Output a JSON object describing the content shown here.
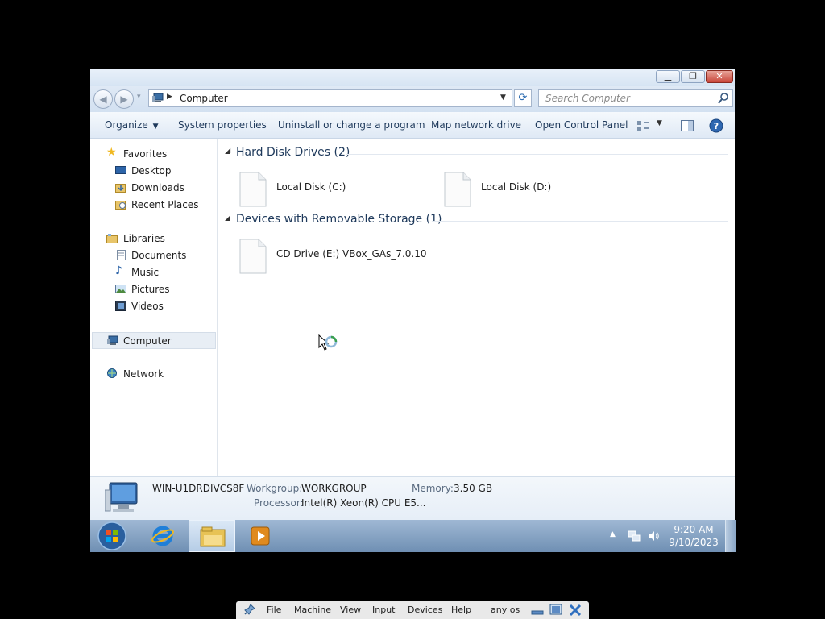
{
  "window": {
    "address_path": "Computer",
    "search_placeholder": "Search Computer"
  },
  "toolbar": {
    "organize": "Organize",
    "system_properties": "System properties",
    "uninstall": "Uninstall or change a program",
    "map_drive": "Map network drive",
    "control_panel": "Open Control Panel"
  },
  "nav": {
    "favorites": "Favorites",
    "desktop": "Desktop",
    "downloads": "Downloads",
    "recent_places": "Recent Places",
    "libraries": "Libraries",
    "documents": "Documents",
    "music": "Music",
    "pictures": "Pictures",
    "videos": "Videos",
    "computer": "Computer",
    "network": "Network"
  },
  "groups": {
    "hard_disk": {
      "title": "Hard Disk Drives (2)",
      "items": [
        "Local Disk (C:)",
        "Local Disk (D:)"
      ]
    },
    "removable": {
      "title": "Devices with Removable Storage (1)",
      "items": [
        "CD Drive (E:) VBox_GAs_7.0.10"
      ]
    }
  },
  "details": {
    "computer_name": "WIN-U1DRDIVCS8F",
    "workgroup_label": "Workgroup:",
    "workgroup_value": "WORKGROUP",
    "memory_label": "Memory:",
    "memory_value": "3.50 GB",
    "processor_label": "Processor:",
    "processor_value": "Intel(R) Xeon(R) CPU E5..."
  },
  "taskbar": {
    "time": "9:20 AM",
    "date": "9/10/2023"
  },
  "vbox": {
    "menus": [
      "File",
      "Machine",
      "View",
      "Input",
      "Devices",
      "Help"
    ],
    "status": "any os"
  },
  "colors": {
    "accent": "#1e395b",
    "selection": "#e5f3fb"
  }
}
